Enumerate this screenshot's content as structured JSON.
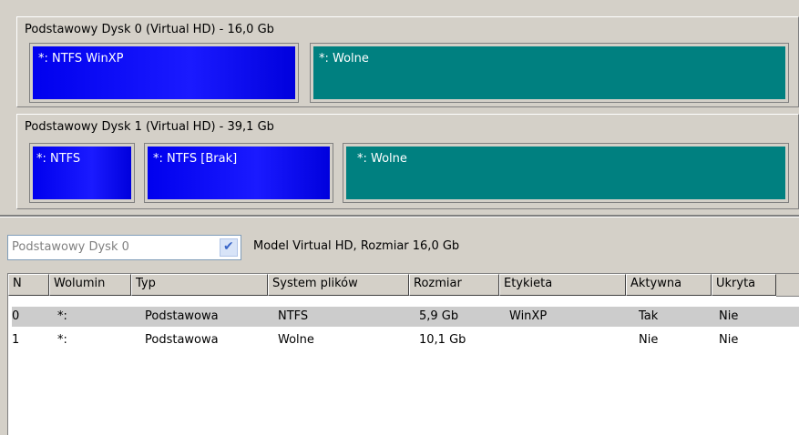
{
  "disks": [
    {
      "title": "Podstawowy Dysk 0 (Virtual HD) - 16,0 Gb",
      "partitions": [
        {
          "label": "*: NTFS WinXP",
          "kind": "ntfs"
        },
        {
          "label": "*: Wolne",
          "kind": "free"
        }
      ]
    },
    {
      "title": "Podstawowy Dysk 1 (Virtual HD) - 39,1 Gb",
      "partitions": [
        {
          "label": "*: NTFS",
          "kind": "ntfs"
        },
        {
          "label": "*: NTFS [Brak]",
          "kind": "ntfs"
        },
        {
          "label": "*: Wolne",
          "kind": "free"
        }
      ]
    }
  ],
  "disk_select": {
    "value": "Podstawowy Dysk 0"
  },
  "model_info": "Model Virtual HD, Rozmiar 16,0 Gb",
  "table": {
    "headers": [
      "N",
      "Wolumin",
      "Typ",
      "System plików",
      "Rozmiar",
      "Etykieta",
      "Aktywna",
      "Ukryta"
    ],
    "rows": [
      [
        "0",
        "*:",
        "Podstawowa",
        "NTFS",
        "5,9 Gb",
        "WinXP",
        "Tak",
        "Nie"
      ],
      [
        "1",
        "*:",
        "Podstawowa",
        "Wolne",
        "10,1 Gb",
        "",
        "Nie",
        "Nie"
      ]
    ],
    "selected_row": 0
  },
  "colors": {
    "ntfs": "#0000ee",
    "free": "#008080",
    "selection": "#cccccc"
  }
}
